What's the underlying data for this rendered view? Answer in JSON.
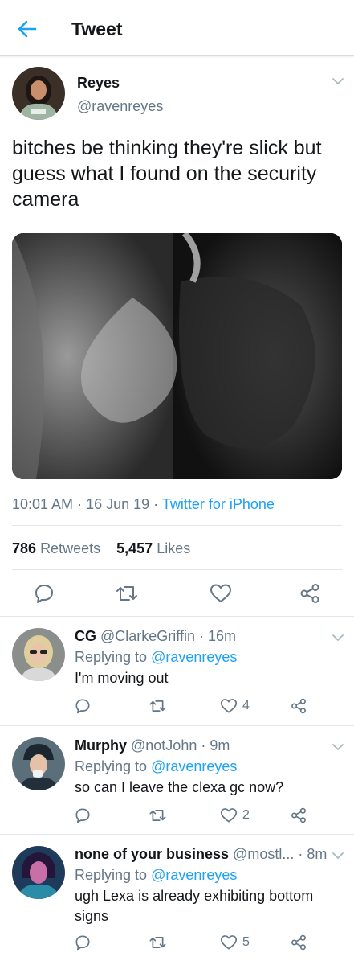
{
  "header": {
    "title": "Tweet"
  },
  "tweet": {
    "author_name": "Reyes",
    "author_handle": "@ravenreyes",
    "text": "bitches be thinking they're slick but guess what I found on the security camera",
    "time": "10:01 AM",
    "date": "16 Jun 19",
    "source": "Twitter for iPhone",
    "retweets_count": "786",
    "retweets_label": "Retweets",
    "likes_count": "5,457",
    "likes_label": "Likes"
  },
  "replies": [
    {
      "name": "CG",
      "handle": "@ClarkeGriffin",
      "time": "16m",
      "replying_label": "Replying to",
      "replying_to": "@ravenreyes",
      "text": "I'm moving out",
      "likes": "4"
    },
    {
      "name": "Murphy",
      "handle": "@notJohn",
      "time": "9m",
      "replying_label": "Replying to",
      "replying_to": "@ravenreyes",
      "text": "so can I leave the clexa gc now?",
      "likes": "2"
    },
    {
      "name": "none of your business",
      "handle": "@mostl...",
      "time": "8m",
      "replying_label": "Replying to",
      "replying_to": "@ravenreyes",
      "text": "ugh Lexa is already exhibiting bottom signs",
      "likes": "5"
    }
  ],
  "colors": {
    "accent": "#1da1f2",
    "text": "#14171a",
    "secondary": "#657786",
    "divider": "#e1e8ed"
  },
  "icons": [
    "back-arrow-icon",
    "chevron-down-icon",
    "reply-icon",
    "retweet-icon",
    "like-icon",
    "share-icon"
  ]
}
